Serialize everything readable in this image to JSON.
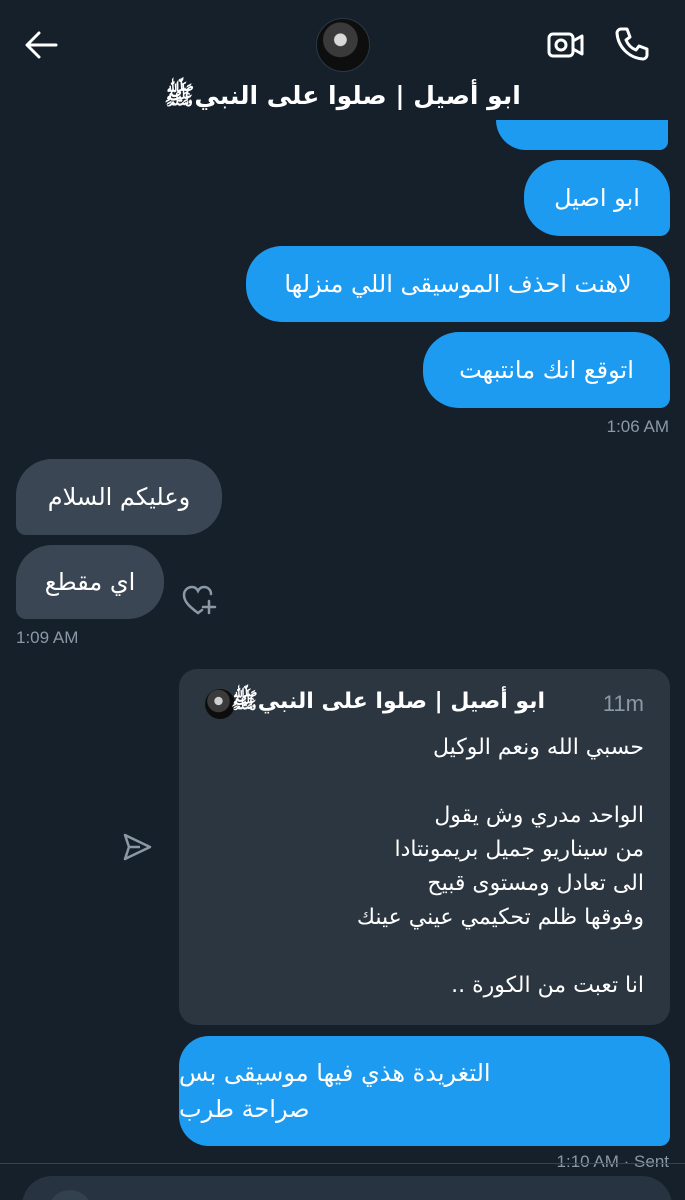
{
  "header": {
    "name": "ابو أصيل | صلوا على النبيﷺ"
  },
  "messages": {
    "m1": "ابو اصيل",
    "m2": "لاهنت احذف الموسيقى اللي منزلها",
    "m3": "اتوقع انك مانتبهت",
    "t1": "1:06 AM",
    "r1": "وعليكم السلام",
    "r2": "اي مقطع",
    "t2": "1:09 AM",
    "last_line1": "التغريدة هذي فيها موسيقى بس",
    "last_line2": "صراحة طرب",
    "status": "1:10 AM · Sent"
  },
  "quote": {
    "name": "ابو أصيل | صلوا على النبيﷺ",
    "time": "11m",
    "lines": [
      "حسبي الله ونعم الوكيل",
      "",
      "الواحد مدري وش يقول",
      "من سيناريو جميل بريمونتادا",
      "الى تعادل ومستوى قبيح",
      "وفوقها ظلم تحكيمي عيني عينك",
      "",
      "انا تعبت من الكورة .."
    ]
  },
  "colors": {
    "background": "#15202b",
    "sent_bubble": "#1d9bf0",
    "received_bubble": "#3a4653",
    "muted_text": "#8b98a5"
  },
  "icons": [
    "back-arrow-icon",
    "video-call-icon",
    "phone-icon",
    "share-icon",
    "add-reaction-icon"
  ]
}
